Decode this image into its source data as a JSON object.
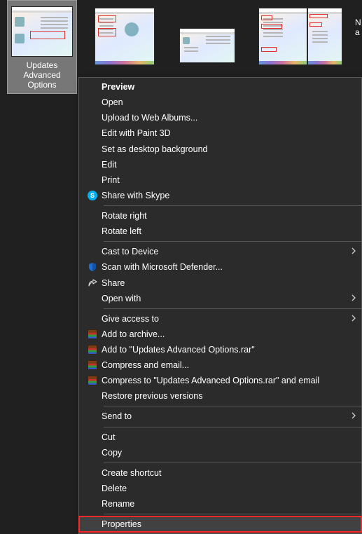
{
  "files": {
    "selected": {
      "caption": "Updates Advanced Options"
    },
    "edge_text": "N\na"
  },
  "menu": {
    "preview": "Preview",
    "open": "Open",
    "upload": "Upload to Web Albums...",
    "paint3d": "Edit with Paint 3D",
    "setbg": "Set as desktop background",
    "edit": "Edit",
    "print": "Print",
    "skype": "Share with Skype",
    "rot_r": "Rotate right",
    "rot_l": "Rotate left",
    "cast": "Cast to Device",
    "defender": "Scan with Microsoft Defender...",
    "share": "Share",
    "openwith": "Open with",
    "giveaccess": "Give access to",
    "rar_add": "Add to archive...",
    "rar_addto": "Add to \"Updates Advanced Options.rar\"",
    "rar_comp": "Compress and email...",
    "rar_compto": "Compress to \"Updates Advanced Options.rar\" and email",
    "restore": "Restore previous versions",
    "sendto": "Send to",
    "cut": "Cut",
    "copy": "Copy",
    "shortcut": "Create shortcut",
    "delete": "Delete",
    "rename": "Rename",
    "properties": "Properties"
  }
}
